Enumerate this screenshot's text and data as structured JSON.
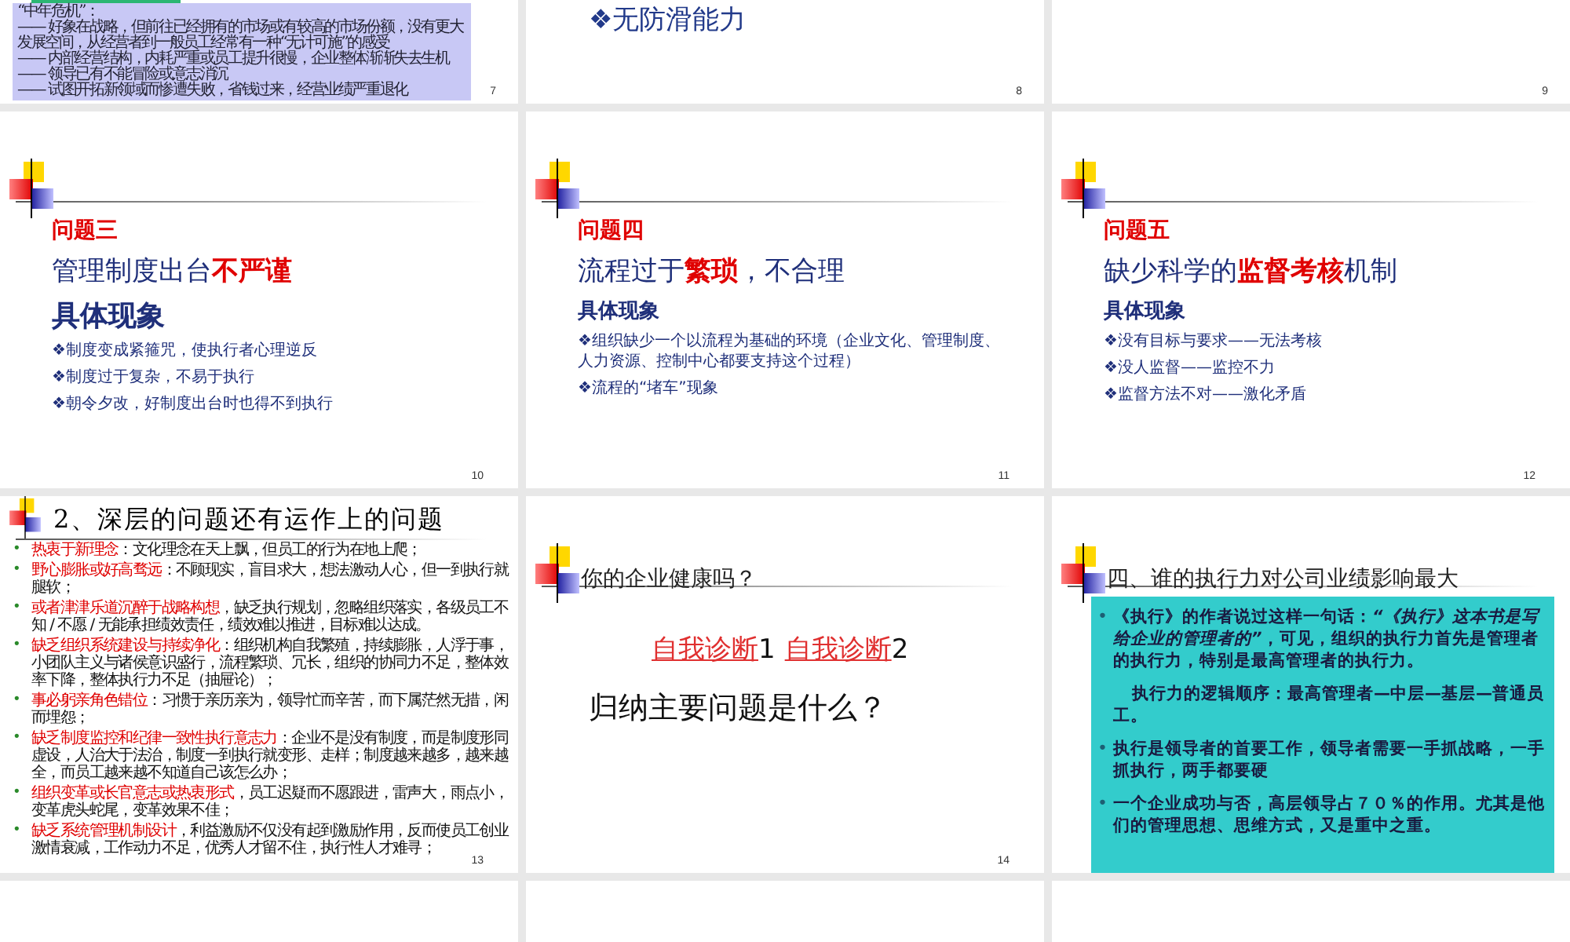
{
  "slides": [
    {
      "kind": "note",
      "number": "7",
      "lines": [
        "“中年危机”：",
        "—— 好象在战略，但前往已经拥有的市场或有较高的市场份额，没有更大发展空间，从经营者到一般员工经常有一种“无计可施”的感受",
        "—— 内部经营结构，内耗严重或员工提升很慢，企业整体渐渐失去生机",
        "—— 领导已有不能冒险或意志消沉",
        "—— 试图开拓新领域而惨遭失败，省钱过来，经营业绩严重退化"
      ]
    },
    {
      "kind": "tail",
      "number": "8",
      "lines": [
        "❖无防滑能力"
      ]
    },
    {
      "kind": "tail",
      "number": "9"
    },
    {
      "kind": "problem",
      "number": "10",
      "heading": "问题三",
      "title": [
        {
          "text": "管理制度出台",
          "highlight": false
        },
        {
          "text": "不严谨",
          "highlight": true
        }
      ],
      "subhead": "具体现象",
      "items": [
        "❖制度变成紧箍咒，使执行者心理逆反",
        "❖制度过于复杂，不易于执行",
        "❖朝令夕改，好制度出台时也得不到执行"
      ]
    },
    {
      "kind": "problem",
      "number": "11",
      "heading": "问题四",
      "title": [
        {
          "text": "流程过于",
          "highlight": false
        },
        {
          "text": "繁琐",
          "highlight": true
        },
        {
          "text": "，不合理",
          "highlight": false
        }
      ],
      "subhead": "具体现象",
      "items": [
        "❖组织缺少一个以流程为基础的环境（企业文化、管理制度、人力资源、控制中心都要支持这个过程）",
        "❖流程的“堵车”现象"
      ]
    },
    {
      "kind": "problem",
      "number": "12",
      "heading": "问题五",
      "title": [
        {
          "text": "缺少科学的",
          "highlight": false
        },
        {
          "text": "监督考核",
          "highlight": true
        },
        {
          "text": "机制",
          "highlight": false
        }
      ],
      "subhead": "具体现象",
      "items": [
        "❖没有目标与要求——无法考核",
        "❖没人监督——监控不力",
        "❖监督方法不对——激化矛盾"
      ]
    },
    {
      "kind": "dense",
      "number": "13",
      "title": "2、深层的问题还有运作上的问题",
      "marker": "•",
      "items": [
        {
          "lead": "热衷于新理念",
          "text": "：文化理念在天上飘，但员工的行为在地上爬；"
        },
        {
          "lead": "野心膨胀或好高骛远",
          "text": "：不顾现实，盲目求大，想法激动人心，但一到执行就腿软；"
        },
        {
          "lead": "或者津津乐道沉醉于战略构想",
          "text": "，缺乏执行规划，忽略组织落实，各级员工不知 / 不愿 / 无能承担绩效责任，绩效难以推进，目标难以达成。"
        },
        {
          "lead": "缺乏组织系统建设与持续净化",
          "text": "：组织机构自我繁殖，持续膨胀，人浮于事，小团队主义与诸侯意识盛行，流程繁琐、冗长，组织的协同力不足，整体效率下降，整体执行力不足（抽屉论）；"
        },
        {
          "lead": "事必躬亲角色错位",
          "text": "：习惯于亲历亲为，领导忙而辛苦，而下属茫然无措，闲而埋怨；"
        },
        {
          "lead": "缺乏制度监控和纪律一致性执行意志力",
          "text": "：企业不是没有制度，而是制度形同虚设，人治大于法治，制度一到执行就变形、走样；制度越来越多，越来越全，而员工越来越不知道自己该怎么办；"
        },
        {
          "lead": "组织变革或长官意志或热衷形式",
          "text": "，员工迟疑而不愿跟进，雷声大，雨点小，变革虎头蛇尾，变革效果不佳；"
        },
        {
          "lead": "缺乏系统管理机制设计",
          "text": "，利益激励不仅没有起到激励作用，反而使员工创业激情衰减，工作动力不足，优秀人才留不住，执行性人才难寻；"
        }
      ]
    },
    {
      "kind": "diagnosis",
      "number": "14",
      "title": "你的企业健康吗？",
      "links": [
        {
          "text": "自我诊断",
          "num": "1"
        },
        {
          "text": "自我诊断",
          "num": "2"
        }
      ],
      "question": "归纳主要问题是什么？"
    },
    {
      "kind": "teal",
      "title": "四、谁的执行力对公司业绩影响最大",
      "marker": "•",
      "paragraphs": [
        {
          "kind": "bullet",
          "text": "《执行》的作者说过这样一句话：*“《执行》这本书是写给企业的管理者的”*，可见，组织的执行力首先是管理者的执行力，特别是最高管理者的执行力。"
        },
        {
          "kind": "indent",
          "text": "执行力的逻辑顺序：最高管理者—中层—基层—普通员工。"
        },
        {
          "kind": "bullet",
          "text": "执行是领导者的首要工作，领导者需要一手抓战略，一手抓执行，两手都要硬"
        },
        {
          "kind": "bullet",
          "text": "一个企业成功与否，高层领导占７０％的作用。尤其是他们的管理思想、思维方式，又是重中之重。"
        }
      ]
    },
    {
      "kind": "blank"
    },
    {
      "kind": "blank"
    },
    {
      "kind": "blank"
    }
  ]
}
